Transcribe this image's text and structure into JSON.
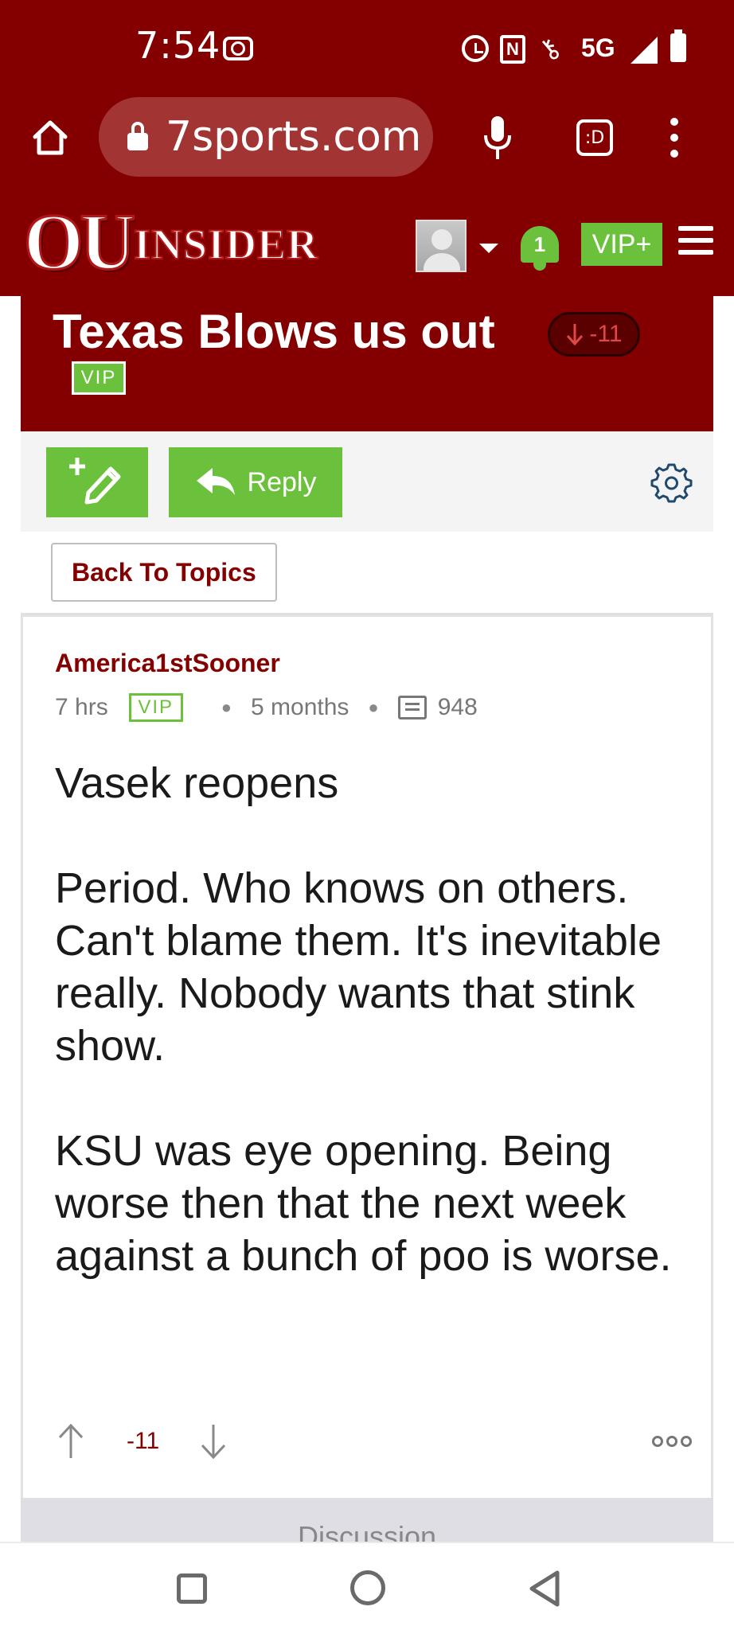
{
  "status_bar": {
    "time": "7:54",
    "network": "5G",
    "icons": [
      "screen-record-icon",
      "alarm-icon",
      "nfc-icon",
      "vpn-key-icon",
      "signal-icon",
      "battery-icon"
    ]
  },
  "browser": {
    "url": "7sports.com",
    "tabs_label": ":D",
    "icons": [
      "home-icon",
      "lock-icon",
      "mic-icon",
      "tabs-icon",
      "kebab-menu-icon"
    ]
  },
  "site_header": {
    "logo_ou": "OU",
    "logo_insider": "INSIDER",
    "notification_count": "1",
    "vip_plus_label": "VIP+"
  },
  "topic": {
    "title": "Texas Blows us out",
    "vote_score": "-11",
    "vip_tag": "VIP"
  },
  "toolbar": {
    "reply_label": "Reply"
  },
  "back_to_topics_label": "Back To Topics",
  "post": {
    "author": "America1stSooner",
    "time_ago": "7 hrs",
    "vip_tag": "VIP",
    "member_for": "5 months",
    "post_count": "948",
    "paragraphs": [
      "Vasek reopens",
      "Period. Who knows on others. Can't blame them. It's inevitable really. Nobody wants that stink show.",
      "KSU was eye opening. Being worse then that the next week against a bunch of poo is worse."
    ],
    "score": "-11"
  },
  "discussion_label": "Discussion",
  "colors": {
    "brand_crimson": "#840000",
    "vip_green": "#6cc13c",
    "negative_score": "#e04848"
  }
}
